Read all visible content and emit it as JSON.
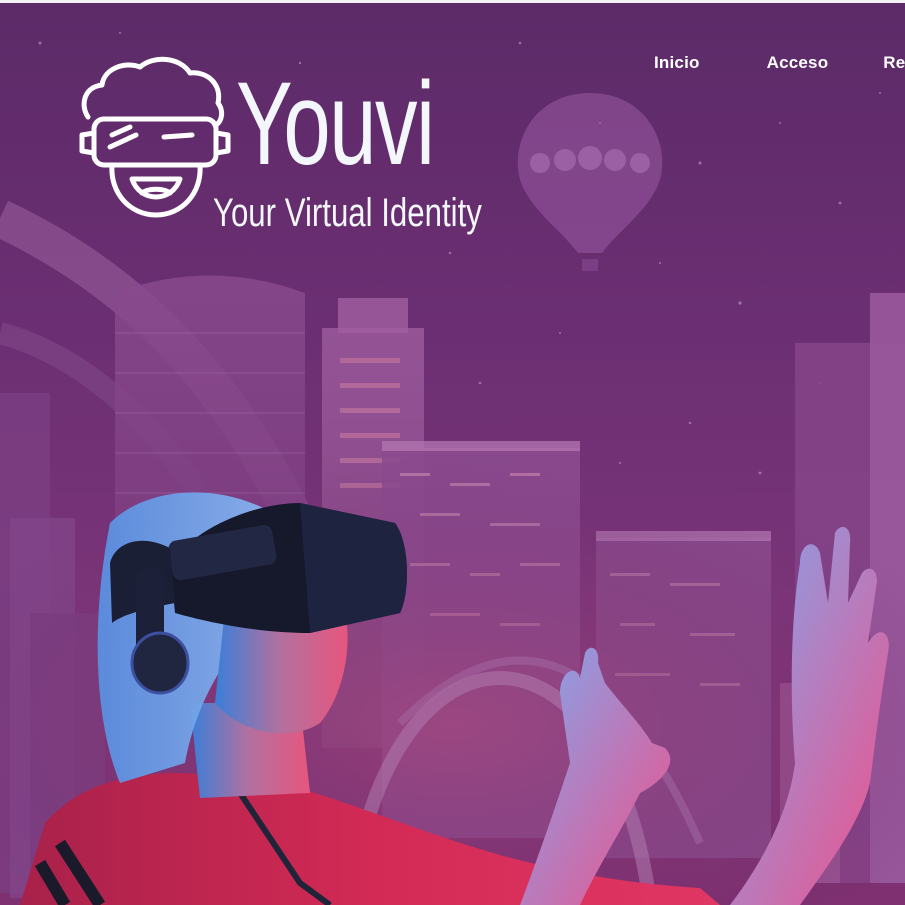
{
  "brand": {
    "name": "Youvi",
    "tagline": "Your Virtual Identity"
  },
  "nav": {
    "items": [
      {
        "label": "Inicio"
      },
      {
        "label": "Acceso"
      },
      {
        "label": "Re"
      }
    ]
  },
  "colors": {
    "background": "#6b2e72",
    "text": "#ffffff",
    "accent_pink": "#e0336e",
    "accent_blue": "#3a8cff"
  },
  "hero": {
    "image": "vr-headset-woman-city-illustration"
  }
}
